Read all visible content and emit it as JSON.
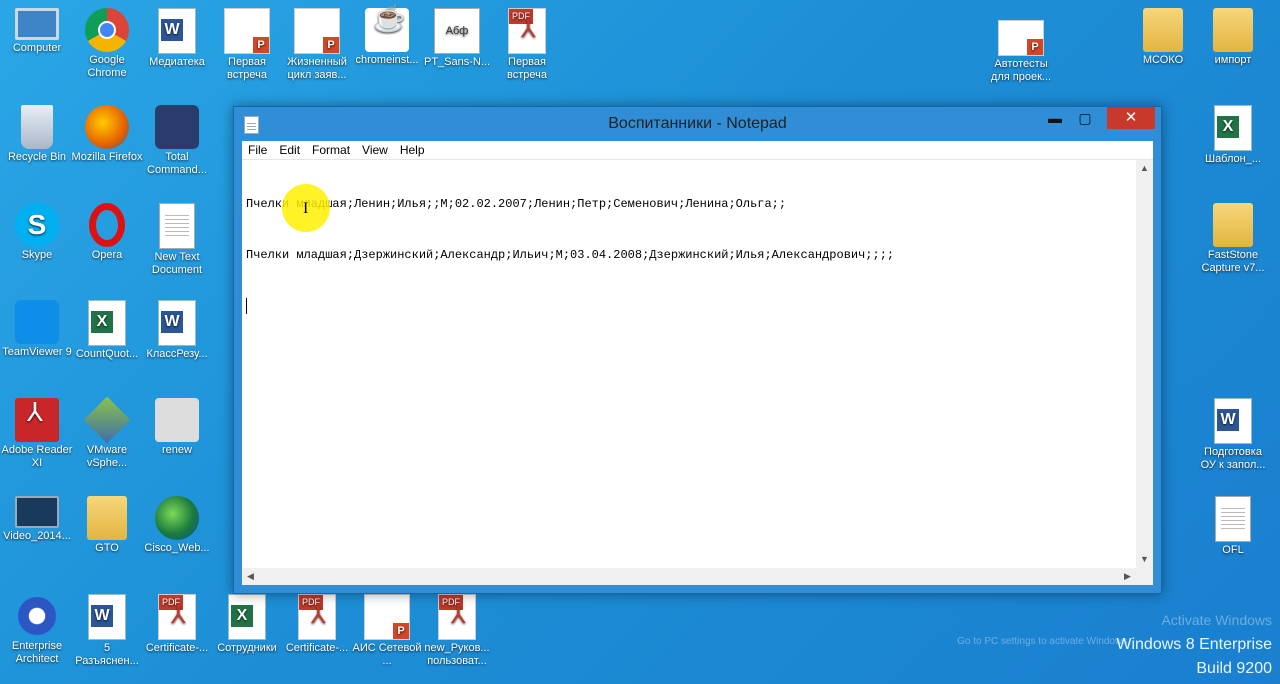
{
  "desktop": {
    "icons_left": [
      {
        "label": "Computer",
        "icon": "computer-icon"
      },
      {
        "label": "Google Chrome",
        "icon": "chrome-icon"
      },
      {
        "label": "Медиатека",
        "icon": "word-doc-icon"
      },
      {
        "label": "Первая встреча",
        "icon": "powerpoint-icon"
      },
      {
        "label": "Жизненный цикл заяв...",
        "icon": "powerpoint-icon"
      },
      {
        "label": "chromeinst...",
        "icon": "java-icon"
      },
      {
        "label": "PT_Sans-N...",
        "icon": "font-icon"
      },
      {
        "label": "Первая встреча",
        "icon": "pdf-icon"
      },
      {
        "label": "Recycle Bin",
        "icon": "recycle-bin-icon"
      },
      {
        "label": "Mozilla Firefox",
        "icon": "firefox-icon"
      },
      {
        "label": "Total Command...",
        "icon": "floppy-icon"
      },
      {
        "label": "Skype",
        "icon": "skype-icon"
      },
      {
        "label": "Opera",
        "icon": "opera-icon"
      },
      {
        "label": "New Text Document",
        "icon": "text-doc-icon"
      },
      {
        "label": "TeamViewer 9",
        "icon": "teamviewer-icon"
      },
      {
        "label": "CountQuot...",
        "icon": "excel-icon"
      },
      {
        "label": "КлассРезу...",
        "icon": "word-doc-icon"
      },
      {
        "label": "Adobe Reader XI",
        "icon": "adobe-reader-icon"
      },
      {
        "label": "VMware vSphe...",
        "icon": "vmware-icon"
      },
      {
        "label": "renew",
        "icon": "settings-file-icon"
      },
      {
        "label": "Video_2014...",
        "icon": "video-icon"
      },
      {
        "label": "GTO",
        "icon": "folder-icon"
      },
      {
        "label": "Cisco_Web...",
        "icon": "cisco-icon"
      },
      {
        "label": "Enterprise Architect",
        "icon": "enterprise-architect-icon"
      },
      {
        "label": "5 Разъяснен...",
        "icon": "word-doc-icon"
      },
      {
        "label": "Certificate-...",
        "icon": "pdf-icon"
      },
      {
        "label": "Сотрудники",
        "icon": "excel-icon"
      },
      {
        "label": "Certificate-...",
        "icon": "pdf-icon"
      },
      {
        "label": "АИС Сетевой ...",
        "icon": "powerpoint-icon"
      },
      {
        "label": "new_Руков... пользоват...",
        "icon": "pdf-icon"
      }
    ],
    "icons_right": [
      {
        "label": "Автотесты для проек...",
        "icon": "powerpoint-icon"
      },
      {
        "label": "МСОКО",
        "icon": "folder-icon"
      },
      {
        "label": "импорт",
        "icon": "folder-icon"
      },
      {
        "label": "Шаблон_...",
        "icon": "excel-icon"
      },
      {
        "label": "FastStone Capture v7...",
        "icon": "folder-icon"
      },
      {
        "label": "Подготовка ОУ к запол...",
        "icon": "word-doc-icon"
      },
      {
        "label": "OFL",
        "icon": "text-doc-icon"
      }
    ],
    "watermark": {
      "activate_line1": "Activate Windows",
      "activate_line2": "Go to PC settings to activate Windows.",
      "edition": "Windows 8 Enterprise",
      "build": "Build 9200"
    }
  },
  "notepad": {
    "title": "Воспитанники - Notepad",
    "controls": {
      "minimize": "▬",
      "maximize": "▢",
      "close": "✕"
    },
    "menu": [
      "File",
      "Edit",
      "Format",
      "View",
      "Help"
    ],
    "lines": [
      "Пчелки младшая;Ленин;Илья;;М;02.02.2007;Ленин;Петр;Семенович;Ленина;Ольга;;",
      "Пчелки младшая;Дзержинский;Александр;Ильич;М;03.04.2008;Дзержинский;Илья;Александрович;;;;"
    ],
    "cursor": "I",
    "scroll_arrows": {
      "up": "▲",
      "down": "▼",
      "left": "◀",
      "right": "▶"
    }
  }
}
